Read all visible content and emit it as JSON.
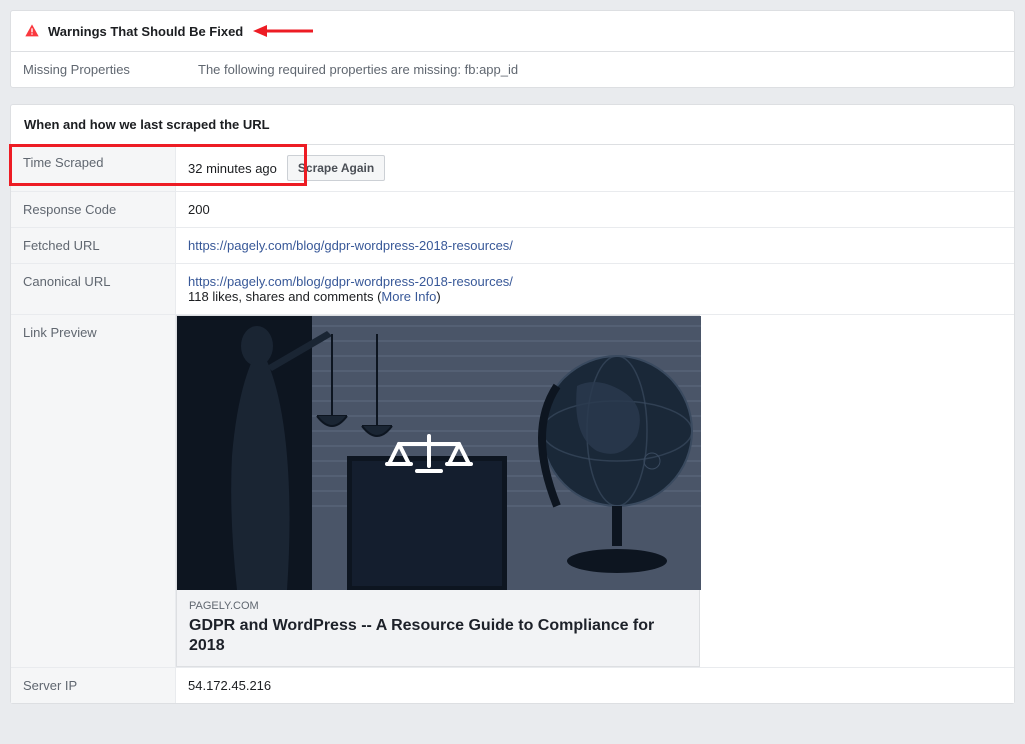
{
  "warnings": {
    "title": "Warnings That Should Be Fixed",
    "label": "Missing Properties",
    "text": "The following required properties are missing: fb:app_id"
  },
  "scrape": {
    "title": "When and how we last scraped the URL",
    "rows": {
      "time_scraped": {
        "label": "Time Scraped",
        "value": "32 minutes ago",
        "button": "Scrape Again"
      },
      "response_code": {
        "label": "Response Code",
        "value": "200"
      },
      "fetched_url": {
        "label": "Fetched URL",
        "value": "https://pagely.com/blog/gdpr-wordpress-2018-resources/"
      },
      "canonical_url": {
        "label": "Canonical URL",
        "value": "https://pagely.com/blog/gdpr-wordpress-2018-resources/",
        "likes_prefix": "118 likes, shares and comments (",
        "more_info": "More Info",
        "likes_suffix": ")"
      },
      "link_preview": {
        "label": "Link Preview",
        "domain": "PAGELY.COM",
        "title": "GDPR and WordPress -- A Resource Guide to Compliance for 2018"
      },
      "server_ip": {
        "label": "Server IP",
        "value": "54.172.45.216"
      }
    }
  }
}
